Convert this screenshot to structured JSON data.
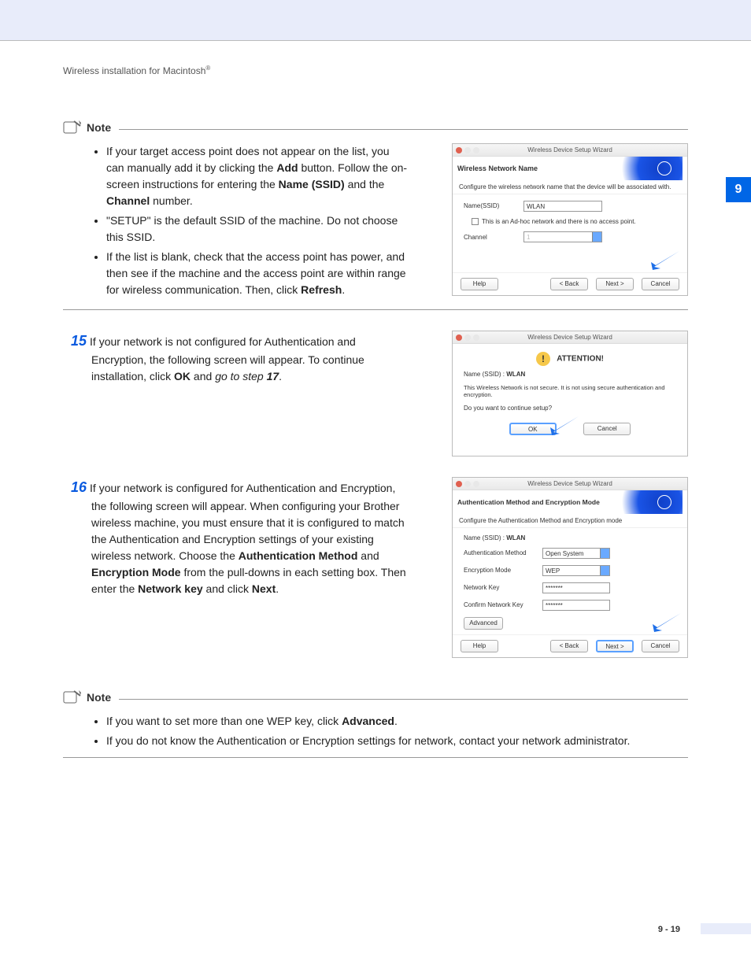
{
  "header": {
    "text": "Wireless installation for Macintosh",
    "trademark": "®"
  },
  "chapterTab": "9",
  "pageNumber": "9 - 19",
  "note1": {
    "label": "Note",
    "bullets": [
      {
        "pre": "If your target access point does not appear on the list, you can manually add it by clicking the ",
        "b1": "Add",
        "mid1": " button. Follow the on-screen instructions for entering the ",
        "b2": "Name (SSID)",
        "mid2": " and the ",
        "b3": "Channel",
        "post": " number."
      },
      {
        "text": "\"SETUP\" is the default SSID of the machine. Do not choose this SSID."
      },
      {
        "pre": "If the list is blank, check that the access point has power, and then see if the machine and the access point are within range for wireless communication. Then, click ",
        "b1": "Refresh",
        "post": "."
      }
    ]
  },
  "step15": {
    "num": "15",
    "pre": "If your network is not configured for Authentication and Encryption, the following screen will appear. To continue installation, click ",
    "b1": "OK",
    "mid": " and ",
    "i1": "go to step ",
    "ib": "17",
    "post": "."
  },
  "step16": {
    "num": "16",
    "pre": "If your network is configured for Authentication and Encryption, the following screen will appear. When configuring your Brother wireless machine, you must ensure that it is configured to match the Authentication and Encryption settings of your existing wireless network. Choose the ",
    "b1": "Authentication Method",
    "mid1": " and ",
    "b2": "Encryption Mode",
    "mid2": " from the pull-downs in each setting box. Then enter the ",
    "b3": "Network key",
    "mid3": " and click ",
    "b4": "Next",
    "post": "."
  },
  "note2": {
    "label": "Note",
    "bullets": [
      {
        "pre": "If you want to set more than one WEP key, click ",
        "b1": "Advanced",
        "post": "."
      },
      {
        "text": "If you do not know the Authentication or Encryption settings for network, contact your network administrator."
      }
    ]
  },
  "wizard1": {
    "windowTitle": "Wireless Device Setup Wizard",
    "title": "Wireless Network Name",
    "sub": "Configure the wireless network name that the device will be associated with.",
    "nameLabel": "Name(SSID)",
    "nameValue": "WLAN",
    "adhoc": "This is an Ad-hoc network and there is no access point.",
    "channelLabel": "Channel",
    "channelValue": "1",
    "help": "Help",
    "back": "< Back",
    "next": "Next >",
    "cancel": "Cancel"
  },
  "wizard2": {
    "windowTitle": "Wireless Device Setup Wizard",
    "attention": "ATTENTION!",
    "nameLabel": "Name (SSID) :",
    "nameValue": "WLAN",
    "msg": "This Wireless Network is not secure. It is not using secure authentication and encryption.",
    "q": "Do you want to continue setup?",
    "ok": "OK",
    "cancel": "Cancel"
  },
  "wizard3": {
    "windowTitle": "Wireless Device Setup Wizard",
    "title": "Authentication Method and Encryption Mode",
    "sub": "Configure the Authentication Method and Encryption mode",
    "nameLabel": "Name (SSID) :",
    "nameValue": "WLAN",
    "authLabel": "Authentication Method",
    "authValue": "Open System",
    "encLabel": "Encryption Mode",
    "encValue": "WEP",
    "netKeyLabel": "Network Key",
    "netKeyValue": "*******",
    "confKeyLabel": "Confirm Network Key",
    "confKeyValue": "*******",
    "advanced": "Advanced",
    "help": "Help",
    "back": "< Back",
    "next": "Next >",
    "cancel": "Cancel"
  }
}
